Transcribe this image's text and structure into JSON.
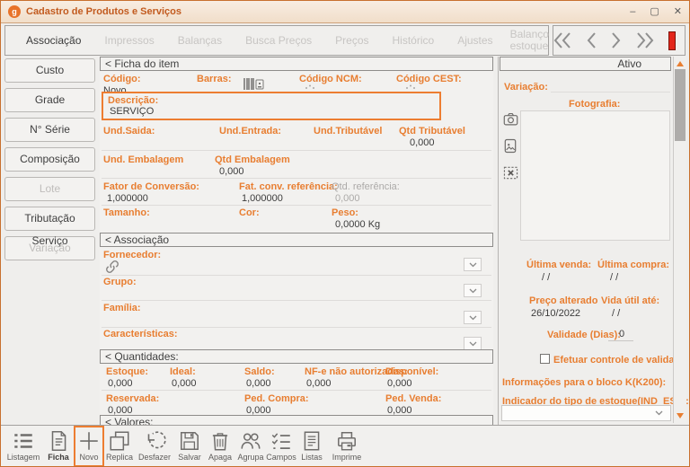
{
  "window": {
    "title": "Cadastro de Produtos e Serviços",
    "app_icon_letter": "g",
    "minimize": "–",
    "maximize": "▢",
    "close": "✕"
  },
  "tabs": {
    "items": [
      {
        "label": "Associação",
        "state": "active"
      },
      {
        "label": "Impressos",
        "state": "disabled"
      },
      {
        "label": "Balanças",
        "state": "disabled"
      },
      {
        "label": "Busca Preços",
        "state": "disabled"
      },
      {
        "label": "Preços",
        "state": "disabled"
      },
      {
        "label": "Histórico",
        "state": "disabled"
      },
      {
        "label": "Ajustes",
        "state": "disabled"
      },
      {
        "label": "Balanço estoque",
        "state": "disabled"
      }
    ]
  },
  "sidebar": {
    "items": [
      {
        "label": "Custo",
        "state": "enabled"
      },
      {
        "label": "Grade",
        "state": "enabled"
      },
      {
        "label": "N° Série",
        "state": "enabled"
      },
      {
        "label": "Composição",
        "state": "enabled"
      },
      {
        "label": "Lote",
        "state": "disabled"
      },
      {
        "label": "Tributação Serviço",
        "state": "enabled"
      },
      {
        "label": "Variação",
        "state": "disabled"
      }
    ]
  },
  "ficha": {
    "header": "< Ficha do item",
    "codigo_label": "Código:",
    "codigo_value": "Novo",
    "barras_label": "Barras:",
    "ncm_label": "Código NCM:",
    "cest_label": "Código CEST:",
    "descricao_label": "Descrição:",
    "descricao_value": "SERVIÇO",
    "und_saida_label": "Und.Saida:",
    "und_entrada_label": "Und.Entrada:",
    "und_tributavel_label": "Und.Tributável",
    "qtd_tributavel_label": "Qtd Tributável",
    "qtd_tributavel_value": "0,000",
    "und_embalagem_label": "Und. Embalagem",
    "qtd_embalagem_label": "Qtd Embalagem",
    "qtd_embalagem_value": "0,000",
    "fator_conversao_label": "Fator de Conversão:",
    "fator_conversao_value": "1,000000",
    "fat_conv_ref_label": "Fat. conv. referência:",
    "fat_conv_ref_value": "1,000000",
    "qtd_ref_label": "Qtd. referência:",
    "qtd_ref_value": "0,000",
    "tamanho_label": "Tamanho:",
    "cor_label": "Cor:",
    "peso_label": "Peso:",
    "peso_value": "0,0000 Kg"
  },
  "associacao": {
    "header": "< Associação",
    "fornecedor_label": "Fornecedor:",
    "grupo_label": "Grupo:",
    "familia_label": "Família:",
    "caracteristicas_label": "Características:"
  },
  "quantidades": {
    "header": "< Quantidades:",
    "row1": [
      {
        "label": "Estoque:",
        "value": "0,000"
      },
      {
        "label": "Ideal:",
        "value": "0,000"
      },
      {
        "label": "Saldo:",
        "value": "0,000"
      },
      {
        "label": "NF-e não autorizadas:",
        "value": "0,000"
      },
      {
        "label": "Disponível:",
        "value": "0,000"
      }
    ],
    "row2": [
      {
        "label": "Reservada:",
        "value": "0,000"
      },
      {
        "label": "Ped. Compra:",
        "value": "0,000"
      },
      {
        "label": "Ped. Venda:",
        "value": "0,000"
      }
    ]
  },
  "valores": {
    "header": "< Valores:"
  },
  "right_panel": {
    "status": "Ativo",
    "variacao_label": "Variação:",
    "fotografia_label": "Fotografia:",
    "ultima_venda_label": "Última venda:",
    "ultima_venda_value": "/ /",
    "ultima_compra_label": "Última compra:",
    "ultima_compra_value": "/ /",
    "preco_alterado_label": "Preço alterado",
    "preco_alterado_value": "26/10/2022",
    "vida_util_label": "Vida útil até:",
    "vida_util_value": "/ /",
    "validade_label": "Validade (Dias):",
    "validade_value": "0",
    "controle_validade_label": "Efetuar controle de validade",
    "controle_validade_checked": false,
    "bloco_k_label": "Informações para o bloco K(K200):",
    "ind_est_label": "Indicador do tipo de estoque(IND_EST):",
    "ind_est_value": ""
  },
  "toolbar": {
    "items": [
      {
        "label": "Listagem"
      },
      {
        "label": "Ficha"
      },
      {
        "label": "Novo",
        "highlighted": true
      },
      {
        "label": "Replica"
      },
      {
        "label": "Desfazer"
      },
      {
        "label": "Salvar"
      },
      {
        "label": "Apaga"
      },
      {
        "label": "Agrupa"
      },
      {
        "label": "Campos"
      },
      {
        "label": "Listas"
      },
      {
        "label": "Imprime"
      }
    ]
  },
  "colors": {
    "accent": "#E87E31",
    "highlight_border": "#ED7D31",
    "red_indicator": "#E3261B",
    "title_text": "#C25A1E"
  }
}
